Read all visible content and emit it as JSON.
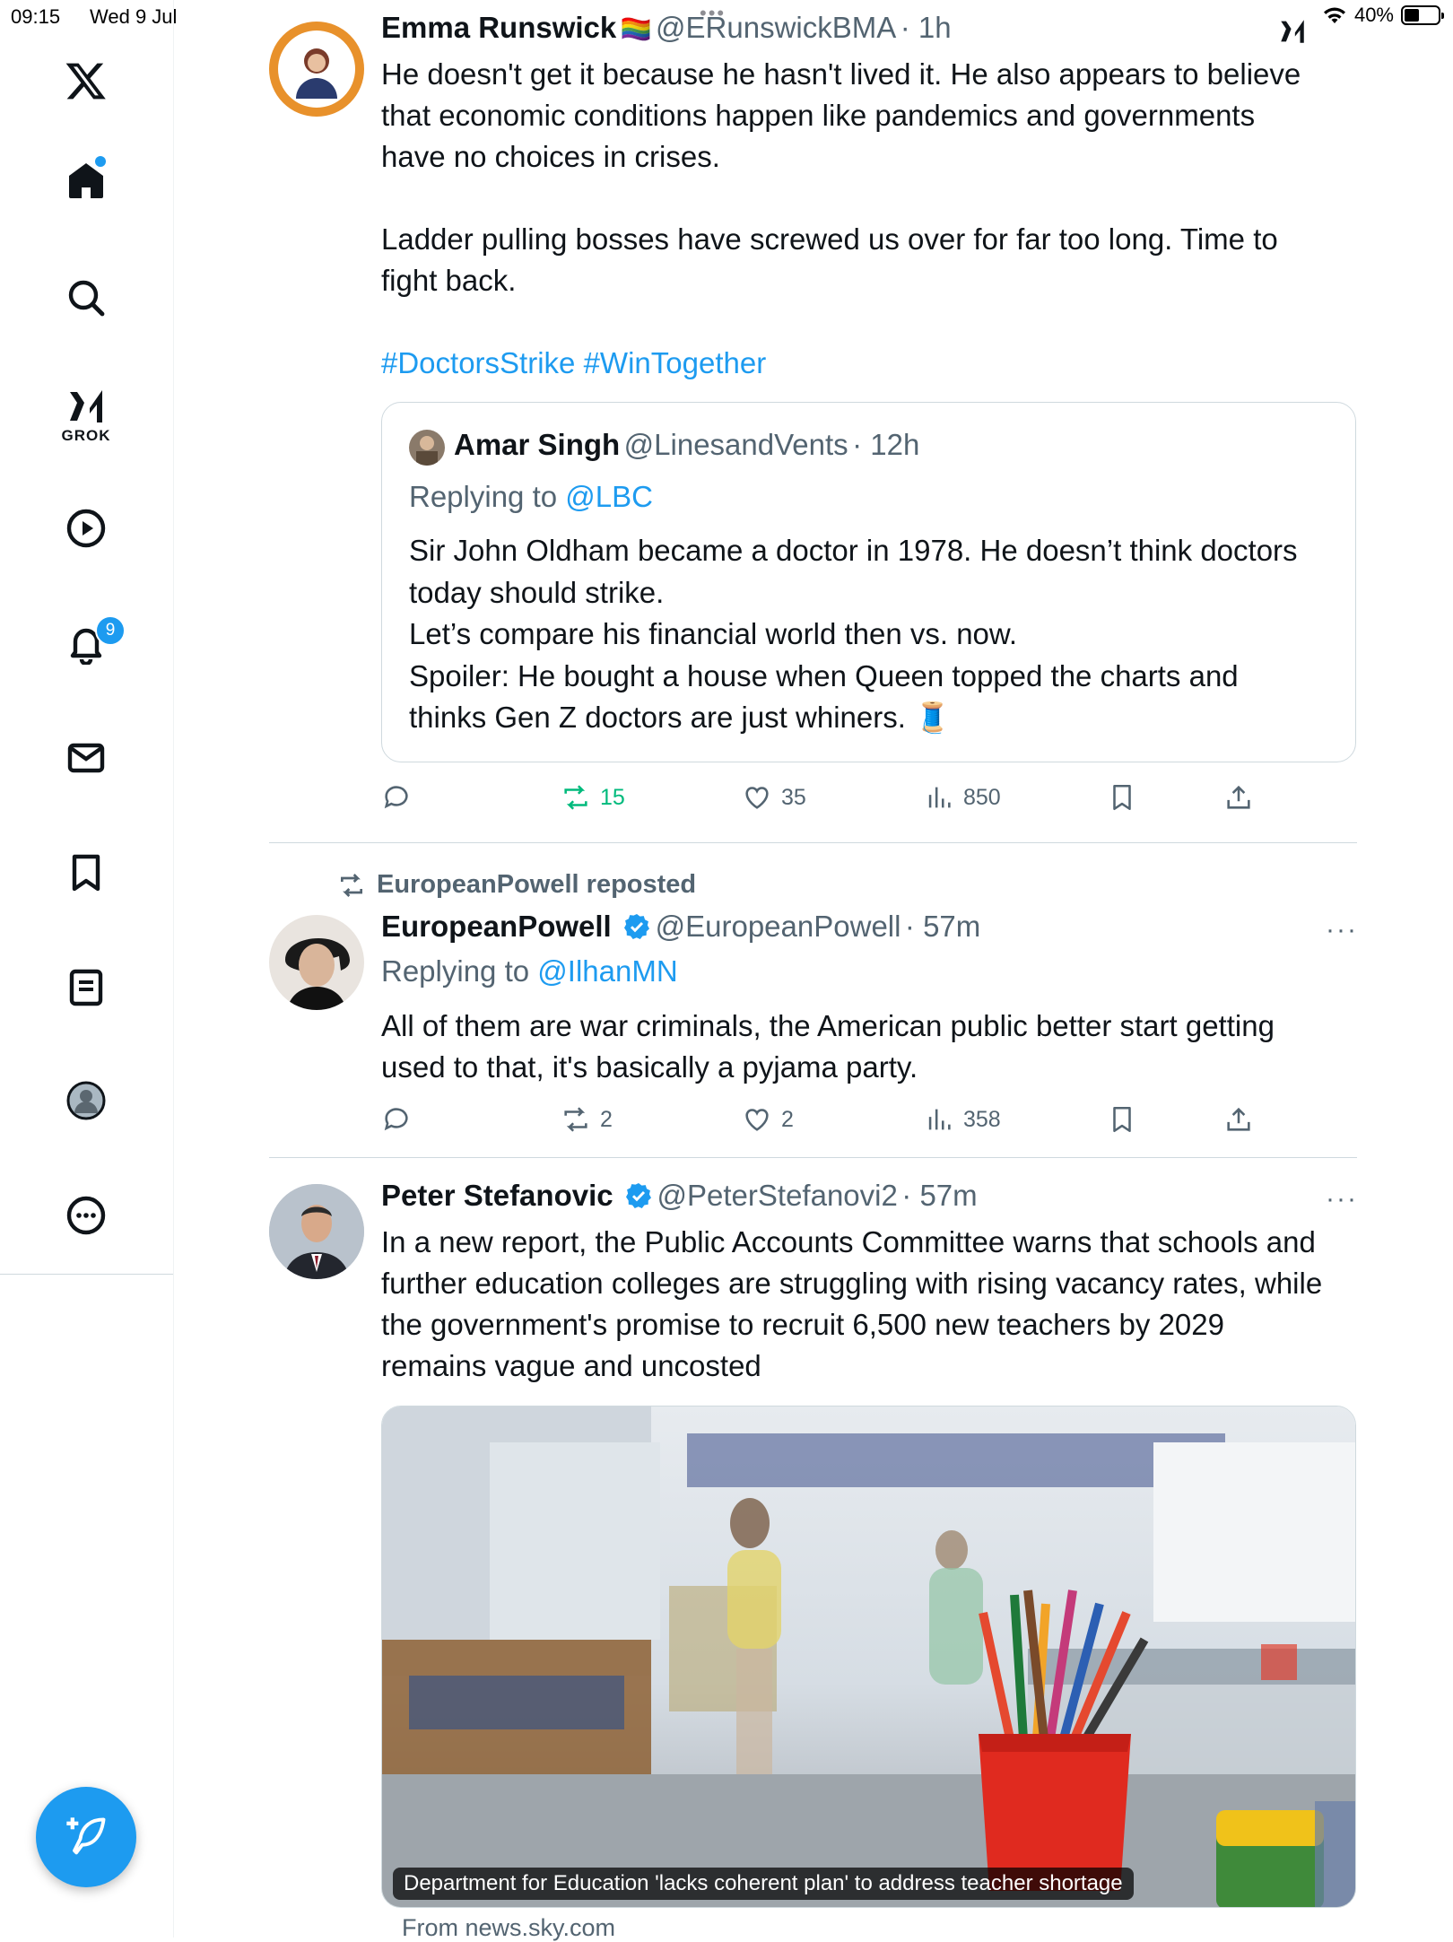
{
  "status_bar": {
    "time": "09:15",
    "date": "Wed 9 Jul",
    "battery": "40%",
    "battery_level": 0.4
  },
  "sidebar": {
    "logo": "x-logo-icon",
    "items": [
      {
        "name": "home",
        "icon": "home-icon"
      },
      {
        "name": "explore",
        "icon": "search-icon"
      },
      {
        "name": "grok",
        "icon": "grok-icon",
        "label": "GROK"
      },
      {
        "name": "videos",
        "icon": "play-icon"
      },
      {
        "name": "notifications",
        "icon": "bell-icon",
        "badge": "9"
      },
      {
        "name": "messages",
        "icon": "mail-icon"
      },
      {
        "name": "bookmarks",
        "icon": "bookmark-icon"
      },
      {
        "name": "lists",
        "icon": "list-icon"
      },
      {
        "name": "profile",
        "icon": "profile-icon"
      },
      {
        "name": "more",
        "icon": "more-circle-icon"
      }
    ],
    "compose_icon": "compose-icon"
  },
  "tweets": [
    {
      "name": "Emma Runswick",
      "name_emoji": "🏳️‍🌈",
      "handle": "@ERunswickBMA",
      "time": "· 1h",
      "body_1": "He doesn't get it because he hasn't lived it. He also appears to believe",
      "body_2": "that economic conditions happen like pandemics and governments",
      "body_3": "have no choices in crises.",
      "body_4": "Ladder pulling bosses have screwed us over for far too long. Time to",
      "body_5": "fight back.",
      "hashtags": "#DoctorsStrike #WinTogether",
      "quote": {
        "name": "Amar Singh",
        "handle": "@LinesandVents",
        "time": "· 12h",
        "replying_prefix": "Replying to",
        "replying_to": "@LBC",
        "line_1": "Sir John Oldham became a doctor in 1978. He doesn’t think doctors",
        "line_2": "today should strike.",
        "line_3": "Let’s compare his financial world then vs. now.",
        "line_4": "Spoiler: He bought a house when Queen topped the charts and",
        "line_5": "thinks Gen Z doctors are just whiners. 🧵"
      },
      "retweets": "15",
      "likes": "35",
      "views": "850"
    },
    {
      "reposted_by": "EuropeanPowell reposted",
      "name": "EuropeanPowell",
      "handle": "@EuropeanPowell",
      "time": "· 57m",
      "replying_prefix": "Replying to",
      "replying_to": "@IlhanMN",
      "body_1": "All of them are war criminals, the American public better start getting",
      "body_2": "used to that, it's basically a pyjama party.",
      "replies": "",
      "retweets": "2",
      "likes": "2",
      "views": "358"
    },
    {
      "name": "Peter Stefanovic",
      "handle": "@PeterStefanovi2",
      "time": "· 57m",
      "body_1": "In a new report, the Public Accounts Committee warns that schools and",
      "body_2": "further education colleges are struggling with rising vacancy rates, while",
      "body_3": "the government's promise to recruit 6,500 new teachers by 2029",
      "body_4": "remains vague and uncosted",
      "card_title": "Department for Education 'lacks coherent plan' to address teacher shortage",
      "card_source": "From news.sky.com"
    }
  ],
  "more_label": "···",
  "colors": {
    "accent": "#1d9bf0",
    "repost_green": "#00ba7c",
    "text_primary": "#0f1419",
    "text_secondary": "#536471"
  }
}
